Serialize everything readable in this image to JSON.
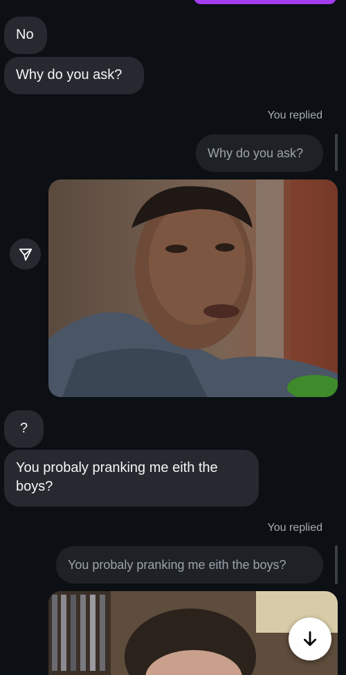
{
  "messages": {
    "received": [
      {
        "text": "No"
      },
      {
        "text": "Why do you ask?"
      },
      {
        "text": "?"
      },
      {
        "text": "You probaly pranking me eith the boys?"
      }
    ],
    "replies": [
      {
        "label": "You replied",
        "quoted": "Why do you ask?"
      },
      {
        "label": "You replied",
        "quoted": "You probaly pranking me eith the boys?"
      }
    ]
  },
  "icons": {
    "share": "paper-plane-icon",
    "scroll": "arrow-down-icon"
  },
  "colors": {
    "background": "#0c1014",
    "received_bubble": "#262a30",
    "quote_bubble": "#1e2227",
    "sent_bubble_accent": "#a43cf0",
    "label_gray": "#a8adb4"
  }
}
